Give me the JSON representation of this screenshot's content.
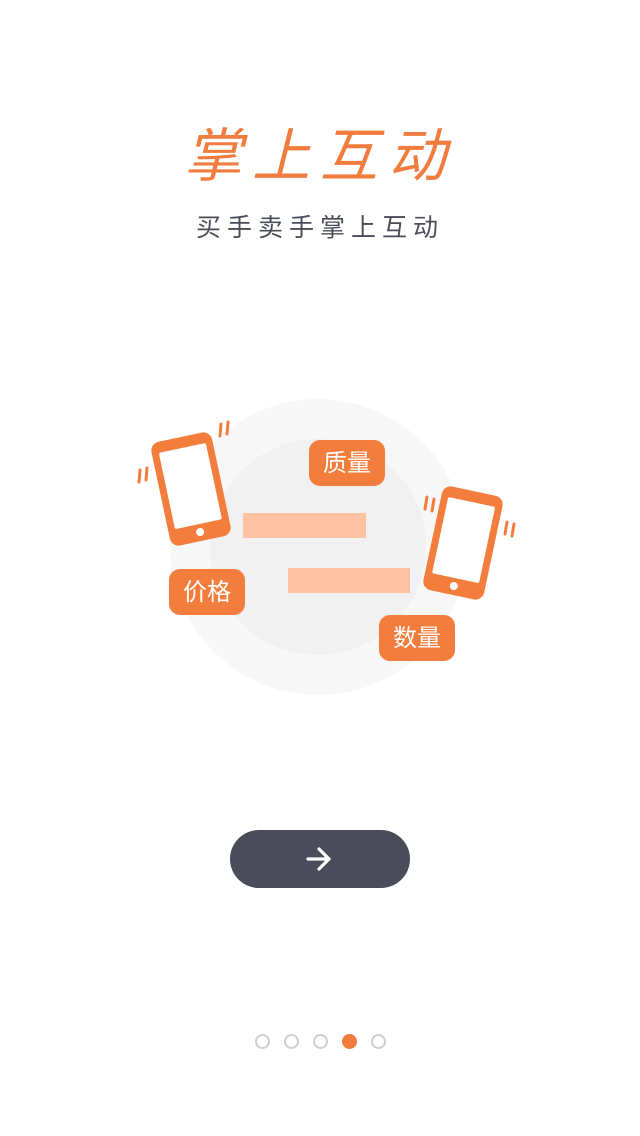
{
  "header": {
    "title": "掌上互动",
    "subtitle": "买手卖手掌上互动"
  },
  "illustration": {
    "tags": [
      {
        "label": "质量"
      },
      {
        "label": "价格"
      },
      {
        "label": "数量"
      }
    ]
  },
  "next_button": {
    "icon": "arrow-right-icon"
  },
  "pager": {
    "total": 5,
    "active_index": 3
  },
  "colors": {
    "accent": "#f07c3e",
    "button": "#4a4c5a",
    "subtitle": "#4a4c58",
    "bar": "#ffc3a4",
    "circle_outer": "#f7f7f7",
    "circle_inner": "#f1f1f1"
  }
}
